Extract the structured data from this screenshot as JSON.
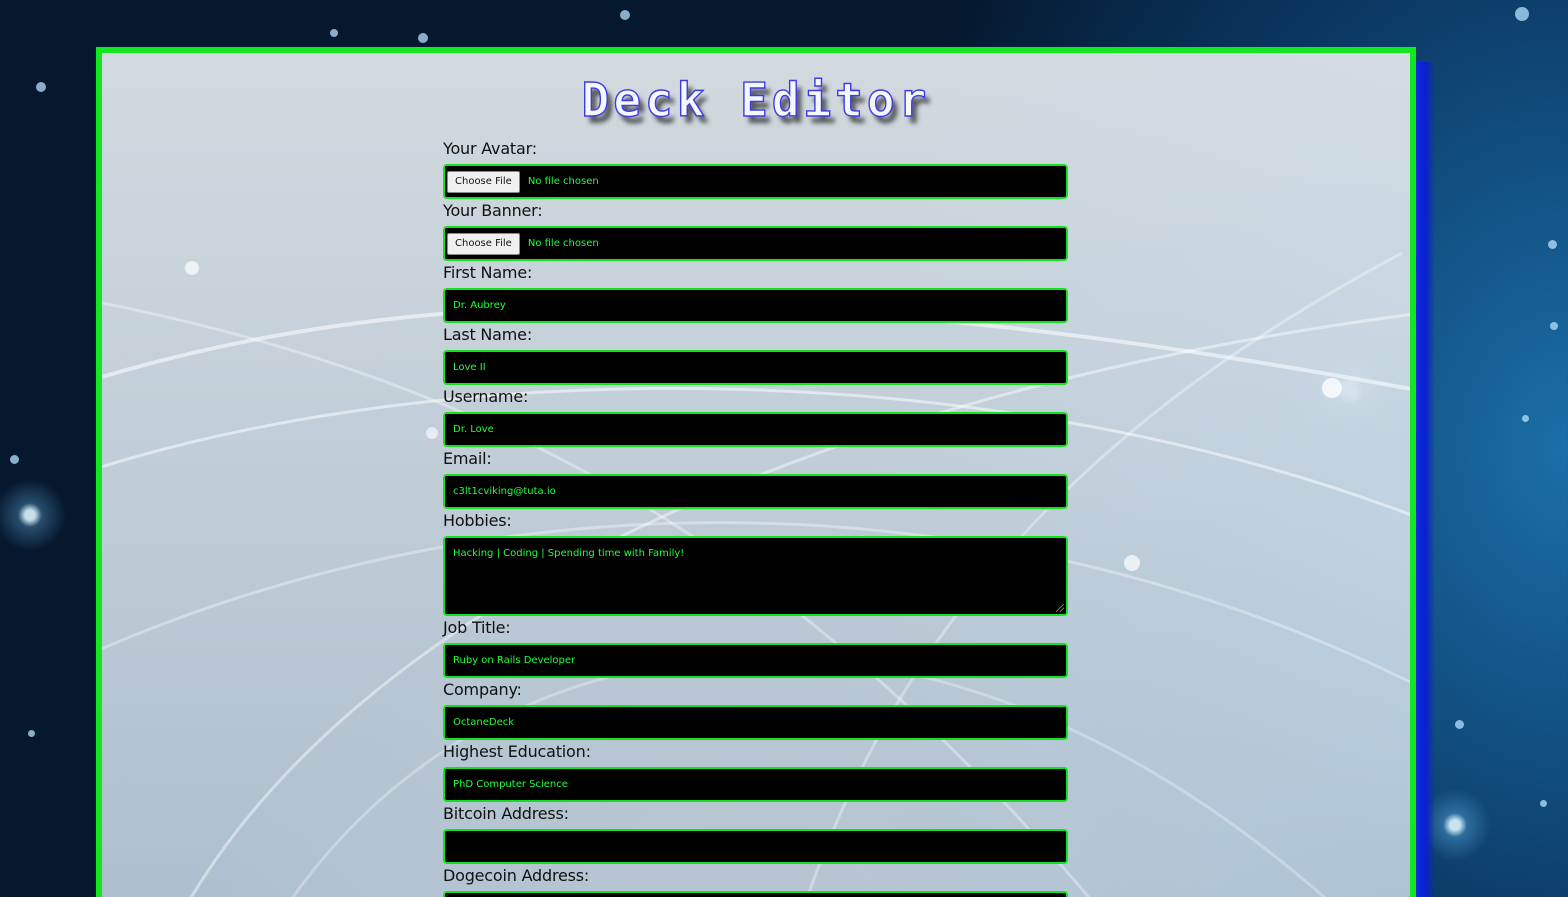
{
  "page": {
    "title": "Deck Editor"
  },
  "form": {
    "avatar": {
      "label": "Your Avatar:",
      "button_label": "Choose File",
      "status": "No file chosen"
    },
    "banner": {
      "label": "Your Banner:",
      "button_label": "Choose File",
      "status": "No file chosen"
    },
    "first_name": {
      "label": "First Name:",
      "value": "Dr. Aubrey"
    },
    "last_name": {
      "label": "Last Name:",
      "value": "Love II"
    },
    "username": {
      "label": "Username:",
      "value": "Dr. Love"
    },
    "email": {
      "label": "Email:",
      "value": "c3lt1cviking@tuta.io"
    },
    "hobbies": {
      "label": "Hobbies:",
      "value": "Hacking | Coding | Spending time with Family!"
    },
    "job_title": {
      "label": "Job Title:",
      "value": "Ruby on Rails Developer"
    },
    "company": {
      "label": "Company:",
      "value": "OctaneDeck"
    },
    "education": {
      "label": "Highest Education:",
      "value": "PhD Computer Science"
    },
    "bitcoin": {
      "label": "Bitcoin Address:",
      "value": ""
    },
    "dogecoin": {
      "label": "Dogecoin Address:",
      "value": ""
    }
  },
  "colors": {
    "accent_green": "#14e21e",
    "field_background": "#000000",
    "field_text": "#20ff3a",
    "title_stroke": "#3c3ce6"
  }
}
